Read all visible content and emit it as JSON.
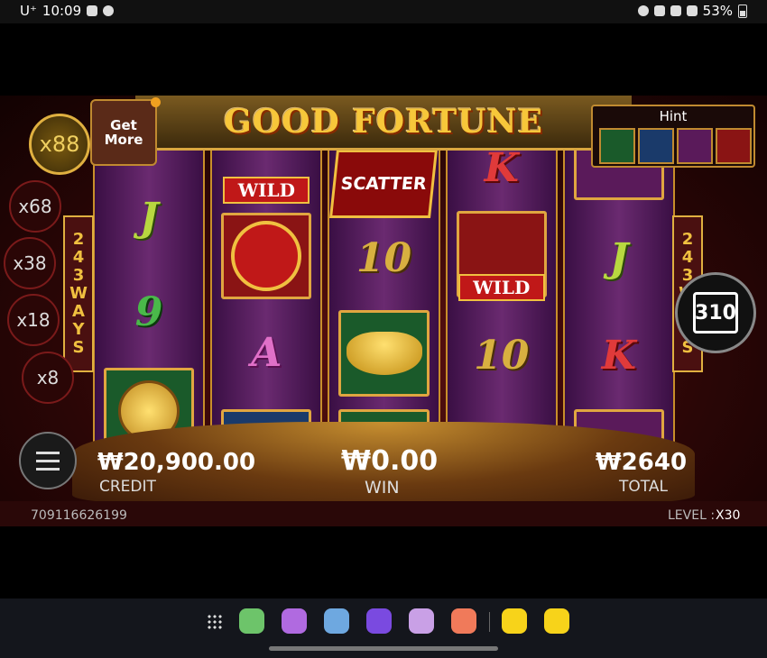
{
  "status_bar": {
    "carrier": "U⁺",
    "time": "10:09",
    "battery": "53%"
  },
  "game": {
    "title": "GOOD FORTUNE",
    "get_more": [
      "Get",
      "More"
    ],
    "multipliers": [
      "x88",
      "x68",
      "x38",
      "x18",
      "x8"
    ],
    "ways_label": [
      "2",
      "4",
      "3",
      "W",
      "A",
      "Y",
      "S"
    ],
    "hint_title": "Hint",
    "hint_icons": [
      "ingot-icon",
      "boat-icon",
      "fan-icon",
      "knot-icon"
    ],
    "reel_counter": "310",
    "wild_label": "WILD",
    "scatter_label": "SCATTER",
    "symbols": {
      "j": "J",
      "nine": "9",
      "a": "A",
      "k": "K",
      "ten": "10"
    },
    "credit_value": "₩20,900.00",
    "credit_label": "CREDIT",
    "win_value": "₩0.00",
    "win_label": "WIN",
    "total_value": "₩2640",
    "total_label": "TOTAL",
    "game_id": "709116626199",
    "level_label": "LEVEL :",
    "level_value": "X30"
  },
  "dock": {
    "apps": [
      {
        "name": "phone-icon",
        "color": "#6dc46a"
      },
      {
        "name": "messages-icon",
        "color": "#b06ae0"
      },
      {
        "name": "gallery-icon",
        "color": "#6ea8e0"
      },
      {
        "name": "pen-icon",
        "color": "#7a4ae0"
      },
      {
        "name": "notes-icon",
        "color": "#c9a0e6"
      },
      {
        "name": "camera-icon",
        "color": "#f07a5a"
      },
      {
        "name": "kakaotalk-icon",
        "color": "#f7d31a"
      },
      {
        "name": "kakao-app-icon",
        "color": "#f7d31a"
      }
    ]
  }
}
